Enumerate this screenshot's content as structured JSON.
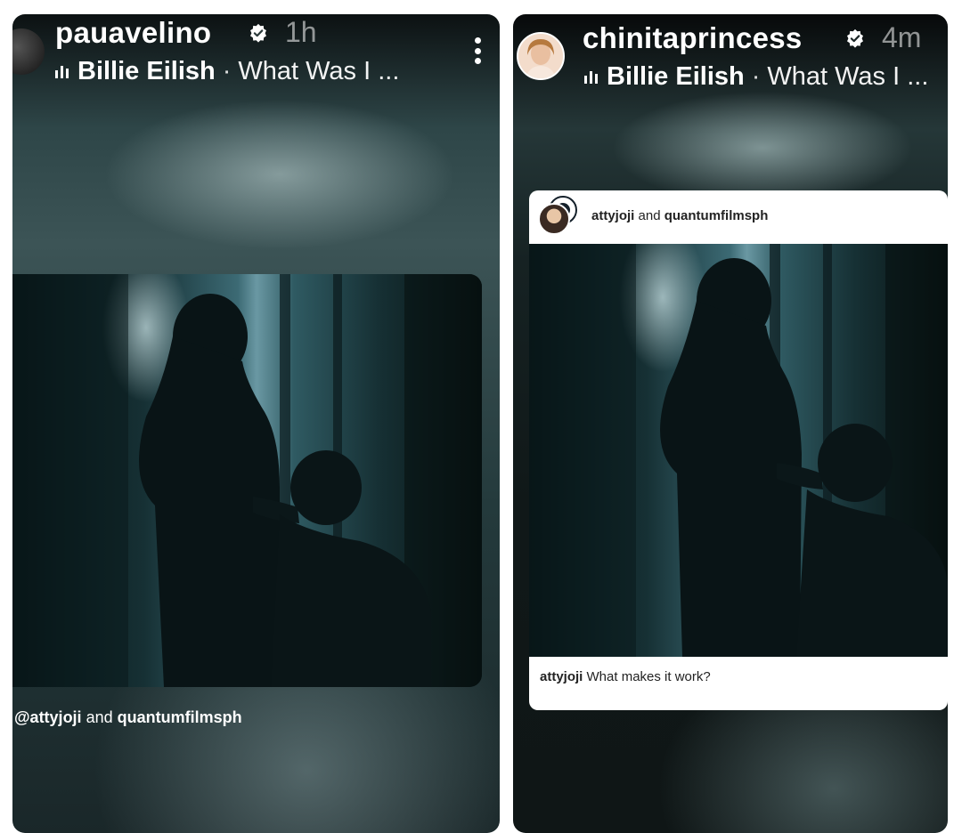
{
  "left_story": {
    "username": "pauavelino",
    "time": "1h",
    "music": {
      "artist": "Billie Eilish",
      "separator": "·",
      "song": "What Was I ..."
    },
    "mention": {
      "user1": "@attyjoji",
      "joiner": "and",
      "user2": "quantumfilmsph"
    }
  },
  "right_story": {
    "username": "chinitaprincess",
    "time": "4m",
    "music": {
      "artist": "Billie Eilish",
      "separator": "·",
      "song": "What Was I ..."
    },
    "post": {
      "collab": {
        "user1": "attyjoji",
        "joiner": "and",
        "user2": "quantumfilmsph"
      },
      "caption": {
        "user": "attyjoji",
        "text": "What makes it work?"
      }
    }
  },
  "icons": {
    "verified": "verified-badge-icon",
    "more": "more-options-icon",
    "music": "music-bars-icon"
  },
  "colors": {
    "text_primary": "#ffffff",
    "verified_badge": "#ffffff",
    "caption_text": "#222222"
  }
}
